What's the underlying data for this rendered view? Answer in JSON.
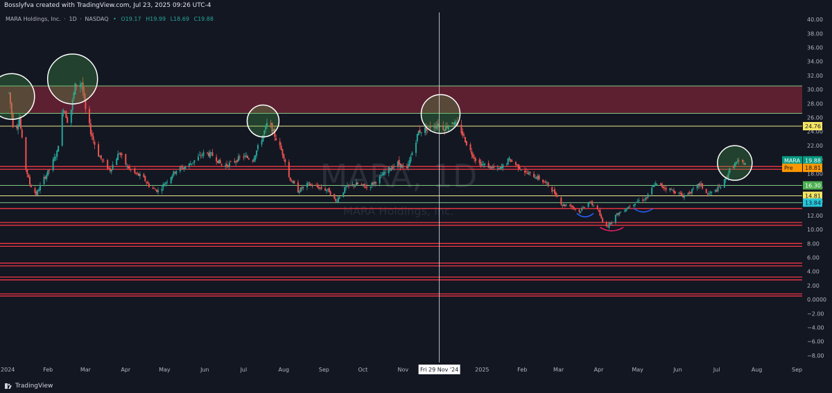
{
  "header": {
    "credit": "Bosslyfva created with TradingView.com, Jul 23, 2025 09:26 UTC-4"
  },
  "footer": {
    "brand": "TradingView"
  },
  "colors": {
    "background": "#131722",
    "bull": "#26a69a",
    "bear": "#ef5350",
    "resistance_zone": "#6b2233",
    "support_green": "#81c784",
    "level_yellow": "#f0e68c",
    "level_red": "#f23645"
  },
  "chart_data": {
    "type": "candlestick",
    "symbol_line": {
      "name": "MARA Holdings, Inc.",
      "interval": "1D",
      "exchange": "NASDAQ",
      "open": "O19.17",
      "high": "H19.99",
      "low": "L18.69",
      "close": "C19.88"
    },
    "watermark": {
      "ticker": "MARA, 1D",
      "company": "MARA Holdings, Inc."
    },
    "ylim": [
      -9,
      41
    ],
    "xlim": [
      "2023-12-26",
      "2025-09-05"
    ],
    "y_ticks": [
      "40.00",
      "38.00",
      "36.00",
      "34.00",
      "32.00",
      "30.00",
      "28.00",
      "26.00",
      "24.00",
      "22.00",
      "20.00",
      "18.00",
      "16.00",
      "14.00",
      "12.00",
      "10.00",
      "8.00",
      "6.00",
      "4.00",
      "2.00",
      "0.0000",
      "−2.00",
      "−4.00",
      "−6.00",
      "−8.00"
    ],
    "x_ticks": [
      {
        "label": "2024",
        "date": "2024-01-01"
      },
      {
        "label": "Feb",
        "date": "2024-02-01"
      },
      {
        "label": "Mar",
        "date": "2024-03-01"
      },
      {
        "label": "Apr",
        "date": "2024-04-01"
      },
      {
        "label": "May",
        "date": "2024-05-01"
      },
      {
        "label": "Jun",
        "date": "2024-06-01"
      },
      {
        "label": "Jul",
        "date": "2024-07-01"
      },
      {
        "label": "Aug",
        "date": "2024-08-01"
      },
      {
        "label": "Sep",
        "date": "2024-09-01"
      },
      {
        "label": "Oct",
        "date": "2024-10-01"
      },
      {
        "label": "Nov",
        "date": "2024-11-01"
      },
      {
        "label": "2025",
        "date": "2025-01-01"
      },
      {
        "label": "Feb",
        "date": "2025-02-01"
      },
      {
        "label": "Mar",
        "date": "2025-03-01"
      },
      {
        "label": "Apr",
        "date": "2025-04-01"
      },
      {
        "label": "May",
        "date": "2025-05-01"
      },
      {
        "label": "Jun",
        "date": "2025-06-01"
      },
      {
        "label": "Jul",
        "date": "2025-07-01"
      },
      {
        "label": "Aug",
        "date": "2025-08-01"
      },
      {
        "label": "Sep",
        "date": "2025-09-01"
      }
    ],
    "crosshair": {
      "date": "2024-11-29",
      "label": "Fri 29 Nov '24"
    },
    "price_path": [
      [
        "2024-01-02",
        29.5
      ],
      [
        "2024-01-06",
        23.5
      ],
      [
        "2024-01-10",
        26.0
      ],
      [
        "2024-01-14",
        19.5
      ],
      [
        "2024-01-18",
        16.5
      ],
      [
        "2024-01-23",
        15.0
      ],
      [
        "2024-01-28",
        17.0
      ],
      [
        "2024-02-02",
        18.5
      ],
      [
        "2024-02-08",
        21.0
      ],
      [
        "2024-02-13",
        27.5
      ],
      [
        "2024-02-17",
        25.0
      ],
      [
        "2024-02-22",
        30.5
      ],
      [
        "2024-02-27",
        31.0
      ],
      [
        "2024-03-01",
        27.0
      ],
      [
        "2024-03-05",
        24.0
      ],
      [
        "2024-03-10",
        21.0
      ],
      [
        "2024-03-15",
        19.5
      ],
      [
        "2024-03-20",
        18.5
      ],
      [
        "2024-03-27",
        21.0
      ],
      [
        "2024-04-02",
        19.0
      ],
      [
        "2024-04-08",
        18.0
      ],
      [
        "2024-04-14",
        17.5
      ],
      [
        "2024-04-20",
        16.0
      ],
      [
        "2024-04-26",
        15.5
      ],
      [
        "2024-05-03",
        17.0
      ],
      [
        "2024-05-10",
        18.5
      ],
      [
        "2024-05-18",
        19.0
      ],
      [
        "2024-05-25",
        20.0
      ],
      [
        "2024-06-01",
        21.0
      ],
      [
        "2024-06-08",
        20.5
      ],
      [
        "2024-06-15",
        19.0
      ],
      [
        "2024-06-22",
        19.5
      ],
      [
        "2024-06-30",
        20.5
      ],
      [
        "2024-07-08",
        20.0
      ],
      [
        "2024-07-15",
        23.0
      ],
      [
        "2024-07-20",
        25.5
      ],
      [
        "2024-07-26",
        23.0
      ],
      [
        "2024-08-01",
        20.5
      ],
      [
        "2024-08-05",
        17.5
      ],
      [
        "2024-08-12",
        15.5
      ],
      [
        "2024-08-20",
        16.5
      ],
      [
        "2024-08-28",
        16.0
      ],
      [
        "2024-09-05",
        15.5
      ],
      [
        "2024-09-10",
        14.0
      ],
      [
        "2024-09-18",
        16.0
      ],
      [
        "2024-09-26",
        16.5
      ],
      [
        "2024-10-04",
        16.0
      ],
      [
        "2024-10-12",
        17.0
      ],
      [
        "2024-10-20",
        18.5
      ],
      [
        "2024-10-28",
        19.5
      ],
      [
        "2024-11-04",
        18.5
      ],
      [
        "2024-11-08",
        21.0
      ],
      [
        "2024-11-13",
        24.0
      ],
      [
        "2024-11-20",
        24.5
      ],
      [
        "2024-11-27",
        25.0
      ],
      [
        "2024-12-03",
        24.5
      ],
      [
        "2024-12-09",
        25.5
      ],
      [
        "2024-12-16",
        24.0
      ],
      [
        "2024-12-22",
        21.5
      ],
      [
        "2024-12-29",
        19.5
      ],
      [
        "2025-01-06",
        19.0
      ],
      [
        "2025-01-14",
        18.5
      ],
      [
        "2025-01-22",
        20.0
      ],
      [
        "2025-01-29",
        19.0
      ],
      [
        "2025-02-05",
        18.0
      ],
      [
        "2025-02-12",
        17.5
      ],
      [
        "2025-02-20",
        16.5
      ],
      [
        "2025-02-27",
        15.0
      ],
      [
        "2025-03-04",
        13.5
      ],
      [
        "2025-03-10",
        13.5
      ],
      [
        "2025-03-17",
        12.5
      ],
      [
        "2025-03-24",
        14.0
      ],
      [
        "2025-03-31",
        13.0
      ],
      [
        "2025-04-04",
        11.0
      ],
      [
        "2025-04-08",
        10.5
      ],
      [
        "2025-04-14",
        12.0
      ],
      [
        "2025-04-22",
        13.0
      ],
      [
        "2025-04-30",
        14.0
      ],
      [
        "2025-05-08",
        14.5
      ],
      [
        "2025-05-14",
        16.5
      ],
      [
        "2025-05-22",
        16.0
      ],
      [
        "2025-05-29",
        15.5
      ],
      [
        "2025-06-05",
        14.8
      ],
      [
        "2025-06-12",
        15.5
      ],
      [
        "2025-06-18",
        16.5
      ],
      [
        "2025-06-24",
        15.0
      ],
      [
        "2025-06-30",
        15.5
      ],
      [
        "2025-07-06",
        16.5
      ],
      [
        "2025-07-11",
        18.5
      ],
      [
        "2025-07-16",
        19.5
      ],
      [
        "2025-07-23",
        19.5
      ]
    ],
    "highlight_circles": [
      {
        "date": "2024-01-04",
        "price": 29.0
      },
      {
        "date": "2024-02-20",
        "price": 31.5
      },
      {
        "date": "2024-07-16",
        "price": 25.5
      },
      {
        "date": "2024-11-30",
        "price": 26.5
      },
      {
        "date": "2025-07-15",
        "price": 19.5
      }
    ],
    "resistance_zone": [
      26.6,
      30.5
    ],
    "levels": [
      {
        "price": 24.76,
        "color": "yellow"
      },
      {
        "price": 19.0,
        "color": "red"
      },
      {
        "price": 18.6,
        "color": "red"
      },
      {
        "price": 16.3,
        "color": "green"
      },
      {
        "price": 14.81,
        "color": "yellow"
      },
      {
        "price": 13.84,
        "color": "green"
      },
      {
        "price": 13.0,
        "color": "red"
      },
      {
        "price": 11.0,
        "color": "red"
      },
      {
        "price": 10.6,
        "color": "red"
      },
      {
        "price": 8.0,
        "color": "red"
      },
      {
        "price": 7.6,
        "color": "red"
      },
      {
        "price": 5.2,
        "color": "red"
      },
      {
        "price": 4.8,
        "color": "red"
      },
      {
        "price": 3.2,
        "color": "red"
      },
      {
        "price": 2.8,
        "color": "red"
      },
      {
        "price": 0.8,
        "color": "red"
      },
      {
        "price": 0.5,
        "color": "red"
      }
    ],
    "arcs": [
      {
        "from": "2025-03-15",
        "to": "2025-03-28",
        "price": 12.3,
        "color": "#2962ff"
      },
      {
        "from": "2025-04-02",
        "to": "2025-04-20",
        "price": 10.3,
        "color": "#e91e63"
      },
      {
        "from": "2025-04-28",
        "to": "2025-05-13",
        "price": 13.0,
        "color": "#2962ff"
      }
    ],
    "price_badges": [
      {
        "label": "24.76",
        "price": 24.76,
        "bg": "#f5e663",
        "fg": "#131722"
      },
      {
        "ticker": "MARA",
        "label": "19.88",
        "price": 19.88,
        "bg": "#089981",
        "fg": "#ffffff"
      },
      {
        "ticker": "Pre",
        "label": "18.81",
        "price": 18.81,
        "bg": "#ff9800",
        "fg": "#131722"
      },
      {
        "label": "16.30",
        "price": 16.3,
        "bg": "#4caf50",
        "fg": "#ffffff"
      },
      {
        "label": "14.81",
        "price": 14.81,
        "bg": "#f5e663",
        "fg": "#131722"
      },
      {
        "label": "13.84",
        "price": 13.84,
        "bg": "#26c6da",
        "fg": "#131722"
      }
    ]
  }
}
